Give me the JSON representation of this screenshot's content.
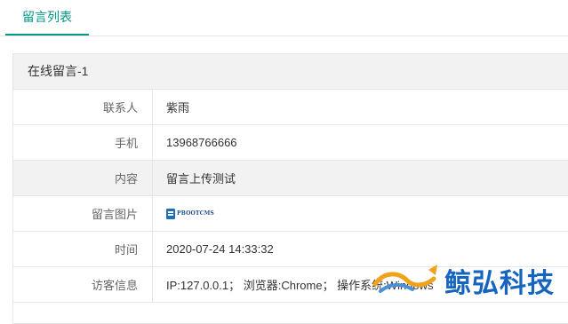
{
  "tabs": [
    {
      "label": "留言列表"
    }
  ],
  "panel": {
    "title": "在线留言-1",
    "rows": [
      {
        "key": "联系人",
        "value": "紫雨"
      },
      {
        "key": "手机",
        "value": "13968766666"
      },
      {
        "key": "内容",
        "value": "留言上传测试"
      },
      {
        "key": "留言图片",
        "image_alt": "PBOOTCMS"
      },
      {
        "key": "时间",
        "value": "2020-07-24 14:33:32"
      },
      {
        "key": "访客信息",
        "value": "IP:127.0.0.1；  浏览器:Chrome；  操作系统:Windows"
      }
    ]
  },
  "watermark": {
    "text": "鲸弘科技"
  },
  "colors": {
    "accent": "#009688",
    "watermark": "#1565c0"
  },
  "icons": [
    "pbootcms-logo-thumbnail",
    "whale-logo"
  ]
}
